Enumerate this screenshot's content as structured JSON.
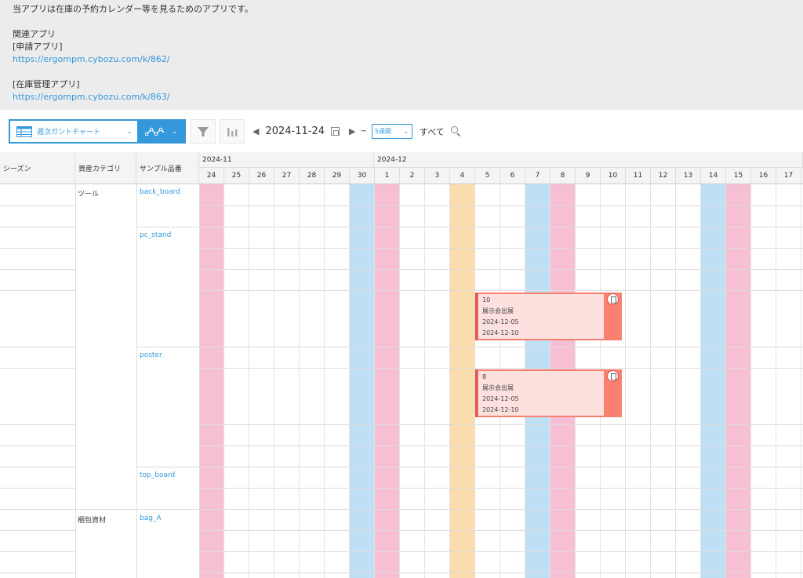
{
  "description": {
    "intro": "当アプリは在庫の予約カレンダー等を見るためのアプリです。",
    "related_title": "関連アプリ",
    "app1_label": "[申請アプリ]",
    "app1_url": "https://ergompm.cybozu.com/k/862/",
    "app2_label": "[在庫管理アプリ]",
    "app2_url": "https://ergompm.cybozu.com/k/863/"
  },
  "toolbar": {
    "view_name": "週次ガントチャート",
    "current_date": "2024-11-24",
    "tilde": "~",
    "range_option": "5週間",
    "all_label": "すべて"
  },
  "grid": {
    "headers": {
      "season": "シーズン",
      "category": "資産カテゴリ",
      "item": "サンプル品番"
    },
    "months": [
      {
        "label": "2024-11"
      },
      {
        "label": "2024-12"
      }
    ],
    "days": [
      {
        "label": "24",
        "color": "pink"
      },
      {
        "label": "25",
        "color": ""
      },
      {
        "label": "26",
        "color": ""
      },
      {
        "label": "27",
        "color": ""
      },
      {
        "label": "28",
        "color": ""
      },
      {
        "label": "29",
        "color": ""
      },
      {
        "label": "30",
        "color": "blue"
      },
      {
        "label": "1",
        "color": "pink"
      },
      {
        "label": "2",
        "color": ""
      },
      {
        "label": "3",
        "color": ""
      },
      {
        "label": "4",
        "color": "orange"
      },
      {
        "label": "5",
        "color": ""
      },
      {
        "label": "6",
        "color": ""
      },
      {
        "label": "7",
        "color": "blue"
      },
      {
        "label": "8",
        "color": "pink"
      },
      {
        "label": "9",
        "color": ""
      },
      {
        "label": "10",
        "color": ""
      },
      {
        "label": "11",
        "color": ""
      },
      {
        "label": "12",
        "color": ""
      },
      {
        "label": "13",
        "color": ""
      },
      {
        "label": "14",
        "color": "blue"
      },
      {
        "label": "15",
        "color": "pink"
      },
      {
        "label": "16",
        "color": ""
      },
      {
        "label": "17",
        "color": ""
      }
    ],
    "categories": [
      {
        "label": "ツール"
      },
      {
        "label": "梱包資材"
      }
    ],
    "items": [
      {
        "label": "back_board"
      },
      {
        "label": "pc_stand"
      },
      {
        "label": "poster"
      },
      {
        "label": "top_board"
      },
      {
        "label": "bag_A"
      }
    ],
    "bookings": [
      {
        "qty": "10",
        "purpose": "展示会出展",
        "start": "2024-12-05",
        "end": "2024-12-10"
      },
      {
        "qty": "8",
        "purpose": "展示会出展",
        "start": "2024-12-05",
        "end": "2024-12-10"
      }
    ]
  },
  "colors": {
    "pink": "#f7bfd4",
    "blue": "#bfdff5",
    "orange": "#fbdcad",
    "accent": "#3498db",
    "bar": "#fa8070"
  }
}
